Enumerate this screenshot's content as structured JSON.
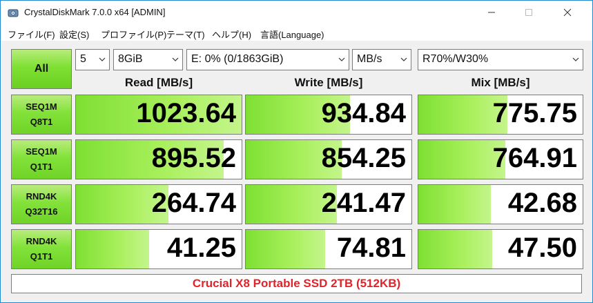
{
  "window": {
    "title": "CrystalDiskMark 7.0.0 x64 [ADMIN]"
  },
  "menu": [
    "ファイル(F)",
    "設定(S)",
    "プロファイル(P)",
    "テーマ(T)",
    "ヘルプ(H)",
    "言語(Language)"
  ],
  "controls": {
    "all_label": "All",
    "count": "5",
    "size": "8GiB",
    "drive": "E: 0% (0/1863GiB)",
    "unit": "MB/s",
    "mix": "R70%/W30%"
  },
  "headers": {
    "read": "Read [MB/s]",
    "write": "Write [MB/s]",
    "mix": "Mix [MB/s]"
  },
  "rows": [
    {
      "line1": "SEQ1M",
      "line2": "Q8T1",
      "read": "1023.64",
      "write": "934.84",
      "mix": "775.75",
      "read_level": 1.0,
      "write_level": 0.63,
      "mix_level": 0.54
    },
    {
      "line1": "SEQ1M",
      "line2": "Q1T1",
      "read": "895.52",
      "write": "854.25",
      "mix": "764.91",
      "read_level": 0.89,
      "write_level": 0.58,
      "mix_level": 0.53
    },
    {
      "line1": "RND4K",
      "line2": "Q32T16",
      "read": "264.74",
      "write": "241.47",
      "mix": "42.68",
      "read_level": 0.56,
      "write_level": 0.55,
      "mix_level": 0.44
    },
    {
      "line1": "RND4K",
      "line2": "Q1T1",
      "read": "41.25",
      "write": "74.81",
      "mix": "47.50",
      "read_level": 0.44,
      "write_level": 0.48,
      "mix_level": 0.45
    }
  ],
  "comment": "Crucial X8 Portable SSD 2TB (512KB)",
  "colors": {
    "accent_green": "#7ee032",
    "comment_red": "#e0242a",
    "window_border": "#1f8ad2"
  }
}
